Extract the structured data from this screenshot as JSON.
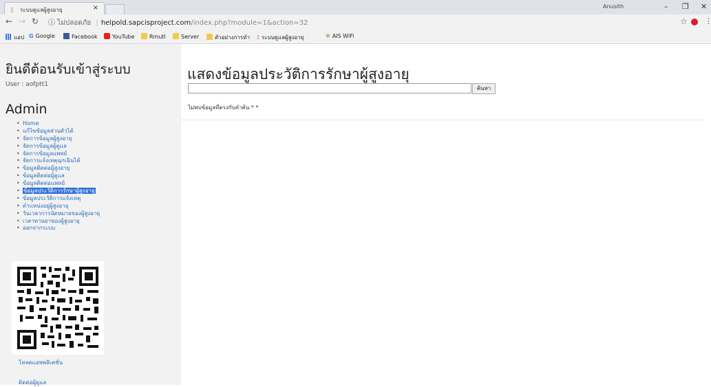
{
  "browser": {
    "tab_title": "ระบบดูแลผู้สูงอายุ",
    "profile": "Anusith",
    "security": "ไม่ปลอดภัย",
    "url_host": "helpold.sapcisproject.com",
    "url_path": "/index.php?module=1&action=32"
  },
  "bookmarks": [
    {
      "label": "แอป"
    },
    {
      "label": "Google"
    },
    {
      "label": "Facebook"
    },
    {
      "label": "YouTube"
    },
    {
      "label": "Rmutl"
    },
    {
      "label": "Server"
    },
    {
      "label": "ตัวอย่างการทำ"
    },
    {
      "label": "ระบบดูแลผู้สูงอายุ"
    },
    {
      "label": "AIS WiFi"
    }
  ],
  "sidebar": {
    "welcome": "ยินดีต้อนรับเข้าสู่ระบบ",
    "user": "User : aofptt1",
    "role": "Admin",
    "menu": [
      {
        "label": "Home"
      },
      {
        "label": "แก้ไขข้อมูลส่วนตัวได้"
      },
      {
        "label": "จัดการข้อมูลผู้สูงอายุ"
      },
      {
        "label": "จัดการข้อมูลผู้ดูแล"
      },
      {
        "label": "จัดการข้อมูลแพทย์"
      },
      {
        "label": "จัดการแจ้งเหตุฉุกเฉินได้"
      },
      {
        "label": "ข้อมูลติดต่อผู้สูงอายุ"
      },
      {
        "label": "ข้อมูลติดต่อผู้ดูแล"
      },
      {
        "label": "ข้อมูลติดต่อแพทย์"
      },
      {
        "label": "ข้อมูลประวัติการรักษาผู้สูงอายุ"
      },
      {
        "label": "ข้อมูลประวัติการแจ้งเหตุ"
      },
      {
        "label": "ตำแหน่งอยู่ผู้สูงอายุ"
      },
      {
        "label": "วันเวลาการนัดหมายของผู้สูงอายุ"
      },
      {
        "label": "เวลาทานยาของผู้สูงอายุ"
      },
      {
        "label": "ออกจากระบบ"
      }
    ],
    "active_index": 9,
    "download_app": "โหลดแอพพลิเคชั่น",
    "contact": "ติดต่อผู้ดูแล"
  },
  "main": {
    "heading": "แสดงข้อมูลประวัติการรักษาผู้สูงอายุ",
    "search_value": "",
    "search_button": "ค้นหา",
    "message": "ไม่พบข้อมูลที่ตรงกับคำค้น * *"
  },
  "icons": {
    "back": "arrow-left-icon",
    "forward": "arrow-right-icon",
    "reload": "reload-icon",
    "info": "info-icon",
    "star": "star-icon",
    "adblock": "adblock-icon",
    "menu": "kebab-menu-icon"
  }
}
